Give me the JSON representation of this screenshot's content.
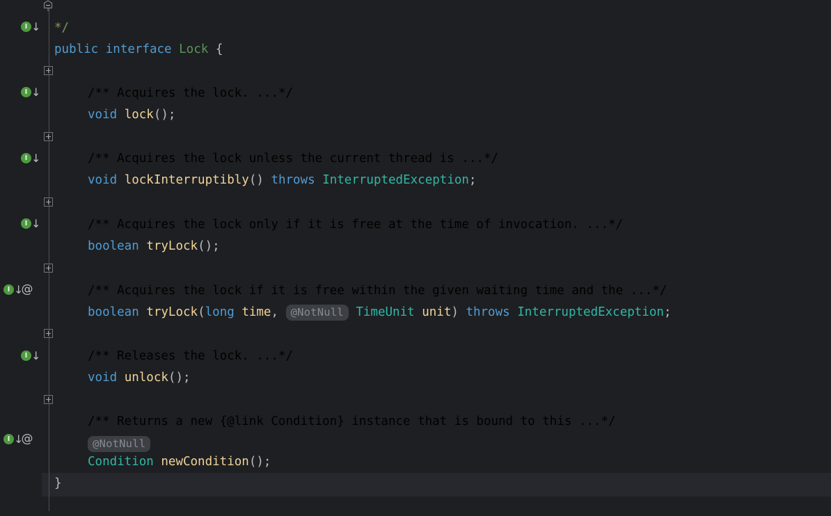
{
  "editor": {
    "language": "java",
    "theme": "darcula",
    "background": "#1e1f22",
    "gutter_background": "#1e1f22",
    "fold_chip_background": "#3c3f41",
    "inlay_background": "#3c3f44",
    "caret_line_background": "#26282e",
    "colors": {
      "keyword": "#4f9dd4",
      "type": "#2fb8a8",
      "interface_name": "#57965c",
      "method_name": "#f0d49a",
      "comment": "#7a9a57",
      "folded_text": "#939597",
      "inlay_text": "#868a91",
      "punctuation": "#bcbec4",
      "gutter_icon_green": "#4f9a41"
    },
    "gutter_icons": {
      "implemented_label": "I",
      "implemented_arrow": "↓",
      "annotation_glyph": "@"
    },
    "lines": [
      {
        "id": "line-comment-end",
        "indent": 0,
        "tokens": [
          {
            "text": "*/",
            "kind": "comment"
          }
        ]
      },
      {
        "id": "line-interface-decl",
        "indent": 0,
        "tokens": [
          {
            "text": "public",
            "kind": "keyword"
          },
          {
            "text": " ",
            "kind": "plain"
          },
          {
            "text": "interface",
            "kind": "keyword"
          },
          {
            "text": " ",
            "kind": "plain"
          },
          {
            "text": "Lock",
            "kind": "interface_name"
          },
          {
            "text": " {",
            "kind": "punctuation"
          }
        ]
      },
      {
        "id": "line-fold-lock",
        "indent": 1,
        "folded": "/** Acquires the lock. ...*/"
      },
      {
        "id": "line-method-lock",
        "indent": 1,
        "tokens": [
          {
            "text": "void",
            "kind": "keyword"
          },
          {
            "text": " ",
            "kind": "plain"
          },
          {
            "text": "lock",
            "kind": "method_name"
          },
          {
            "text": "();",
            "kind": "punctuation"
          }
        ]
      },
      {
        "id": "line-fold-lockInterruptibly",
        "indent": 1,
        "folded": "/** Acquires the lock unless the current thread is ...*/"
      },
      {
        "id": "line-method-lockInterruptibly",
        "indent": 1,
        "tokens": [
          {
            "text": "void",
            "kind": "keyword"
          },
          {
            "text": " ",
            "kind": "plain"
          },
          {
            "text": "lockInterruptibly",
            "kind": "method_name"
          },
          {
            "text": "() ",
            "kind": "punctuation"
          },
          {
            "text": "throws",
            "kind": "keyword"
          },
          {
            "text": " ",
            "kind": "plain"
          },
          {
            "text": "InterruptedException",
            "kind": "type"
          },
          {
            "text": ";",
            "kind": "punctuation"
          }
        ]
      },
      {
        "id": "line-fold-tryLock",
        "indent": 1,
        "folded": "/** Acquires the lock only if it is free at the time of invocation. ...*/"
      },
      {
        "id": "line-method-tryLock",
        "indent": 1,
        "tokens": [
          {
            "text": "boolean",
            "kind": "keyword"
          },
          {
            "text": " ",
            "kind": "plain"
          },
          {
            "text": "tryLock",
            "kind": "method_name"
          },
          {
            "text": "();",
            "kind": "punctuation"
          }
        ]
      },
      {
        "id": "line-fold-tryLock-timeout",
        "indent": 1,
        "folded": "/** Acquires the lock if it is free within the given waiting time and the ...*/"
      },
      {
        "id": "line-method-tryLock-timeout",
        "indent": 1,
        "tokens": [
          {
            "text": "boolean",
            "kind": "keyword"
          },
          {
            "text": " ",
            "kind": "plain"
          },
          {
            "text": "tryLock",
            "kind": "method_name"
          },
          {
            "text": "(",
            "kind": "punctuation"
          },
          {
            "text": "long",
            "kind": "keyword"
          },
          {
            "text": " ",
            "kind": "plain"
          },
          {
            "text": "time",
            "kind": "method_name"
          },
          {
            "text": ", ",
            "kind": "punctuation"
          },
          {
            "text": "@NotNull",
            "kind": "inlay"
          },
          {
            "text": "TimeUnit",
            "kind": "type"
          },
          {
            "text": " ",
            "kind": "plain"
          },
          {
            "text": "unit",
            "kind": "method_name"
          },
          {
            "text": ") ",
            "kind": "punctuation"
          },
          {
            "text": "throws",
            "kind": "keyword"
          },
          {
            "text": " ",
            "kind": "plain"
          },
          {
            "text": "InterruptedException",
            "kind": "type"
          },
          {
            "text": ";",
            "kind": "punctuation"
          }
        ]
      },
      {
        "id": "line-fold-unlock",
        "indent": 1,
        "folded": "/** Releases the lock. ...*/"
      },
      {
        "id": "line-method-unlock",
        "indent": 1,
        "tokens": [
          {
            "text": "void",
            "kind": "keyword"
          },
          {
            "text": " ",
            "kind": "plain"
          },
          {
            "text": "unlock",
            "kind": "method_name"
          },
          {
            "text": "();",
            "kind": "punctuation"
          }
        ]
      },
      {
        "id": "line-fold-newCondition",
        "indent": 1,
        "folded": "/** Returns a new {@link Condition} instance that is bound to this ...*/"
      },
      {
        "id": "line-inlay-notnull",
        "indent": 1,
        "inlay_only": "@NotNull"
      },
      {
        "id": "line-method-newCondition",
        "indent": 1,
        "tokens": [
          {
            "text": "Condition",
            "kind": "type"
          },
          {
            "text": " ",
            "kind": "plain"
          },
          {
            "text": "newCondition",
            "kind": "method_name"
          },
          {
            "text": "();",
            "kind": "punctuation"
          }
        ]
      },
      {
        "id": "line-close-brace",
        "indent": 0,
        "tokens": [
          {
            "text": "}",
            "kind": "punctuation"
          }
        ]
      }
    ]
  },
  "text": {
    "comment_end": "*/",
    "kw_public": "public",
    "kw_interface": "interface",
    "name_lock": "Lock",
    "brace_open": " {",
    "brace_close": "}",
    "fold_lock": "/** Acquires the lock. ...*/",
    "fold_lock_interruptibly": "/** Acquires the lock unless the current thread is ...*/",
    "fold_trylock": "/** Acquires the lock only if it is free at the time of invocation. ...*/",
    "fold_trylock_timeout": "/** Acquires the lock if it is free within the given waiting time and the ...*/",
    "fold_unlock": "/** Releases the lock. ...*/",
    "fold_newcondition": "/** Returns a new {@link Condition} instance that is bound to this ...*/",
    "kw_void": "void",
    "kw_boolean": "boolean",
    "kw_throws": "throws",
    "kw_long": "long",
    "m_lock": "lock",
    "m_lock_interruptibly": "lockInterruptibly",
    "m_trylock": "tryLock",
    "m_unlock": "unlock",
    "m_newcondition": "newCondition",
    "t_interrupted_exception": "InterruptedException",
    "t_timeunit": "TimeUnit",
    "t_condition": "Condition",
    "p_time": "time",
    "p_unit": "unit",
    "paren_empty_semi": "();",
    "paren_close_space": "() ",
    "semi": ";",
    "open_paren": "(",
    "comma_space": ", ",
    "close_paren_space": ") ",
    "space": " ",
    "inlay_notnull": "@NotNull",
    "gutter_i": "I",
    "gutter_arrow": "↓",
    "gutter_at": "@"
  }
}
